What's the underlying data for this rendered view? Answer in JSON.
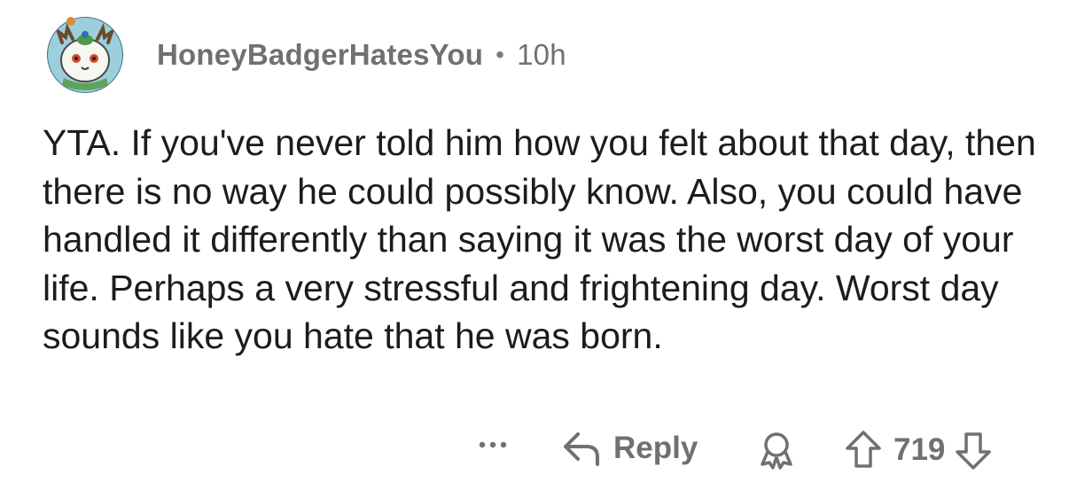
{
  "comment": {
    "username": "HoneyBadgerHatesYou",
    "separator": "•",
    "age": "10h",
    "avatar_icon": "snow-creature-avatar-icon",
    "body": "YTA. If you've never told him how you felt about that day, then there is no way he could possibly know. Also, you could have handled it differently than saying it was the worst day of your life. Perhaps a very stressful and frightening day. Worst day sounds like you hate that he was born."
  },
  "actions": {
    "more_icon": "more-dots-icon",
    "reply_icon": "reply-arrow-icon",
    "reply_label": "Reply",
    "award_icon": "award-icon",
    "upvote_icon": "upvote-arrow-icon",
    "vote_count": "719",
    "downvote_icon": "downvote-arrow-icon"
  },
  "colors": {
    "meta_text": "#6e7074",
    "body_text": "#1c1c1c",
    "avatar_bg": "#7fb8c8",
    "background": "#ffffff"
  }
}
